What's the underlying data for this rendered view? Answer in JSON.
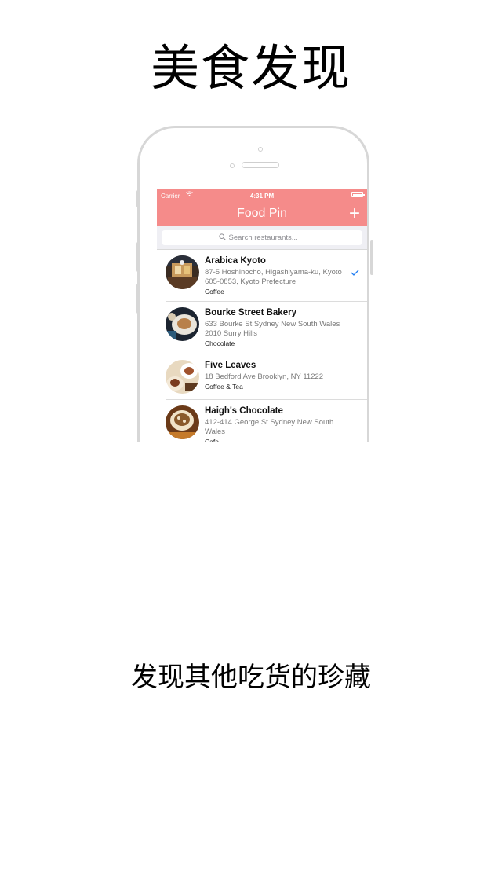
{
  "headline": "美食发现",
  "subline": "发现其他吃货的珍藏",
  "status_bar": {
    "carrier": "Carrier",
    "time": "4:31 PM"
  },
  "nav": {
    "title": "Food Pin",
    "add_label": "+"
  },
  "search": {
    "placeholder": "Search restaurants..."
  },
  "restaurants": [
    {
      "name": "Arabica Kyoto",
      "address": "87-5 Hoshinocho, Higashiyama-ku, Kyoto 605-0853, Kyoto Prefecture",
      "type": "Coffee",
      "checked": true
    },
    {
      "name": "Bourke Street Bakery",
      "address": "633 Bourke St Sydney New South Wales 2010 Surry Hills",
      "type": "Chocolate",
      "checked": false
    },
    {
      "name": "Five Leaves",
      "address": "18 Bedford Ave Brooklyn, NY 11222",
      "type": "Coffee & Tea",
      "checked": false
    },
    {
      "name": "Haigh's Chocolate",
      "address": "412-414 George St Sydney New South Wales",
      "type": "Cafe",
      "checked": false
    }
  ],
  "colors": {
    "nav_background": "#f58b8a",
    "checkmark": "#1e7cf2",
    "nav_text": "#ffffff"
  }
}
